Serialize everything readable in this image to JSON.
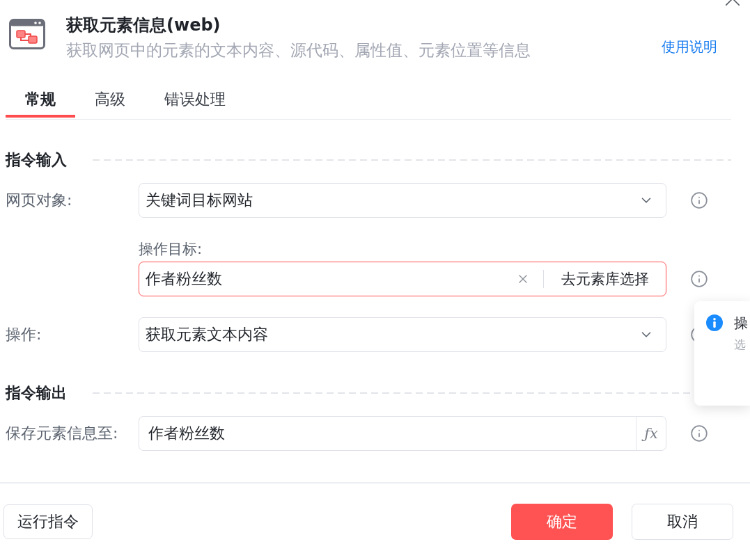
{
  "dialog": {
    "title": "获取元素信息(web)",
    "description": "获取网页中的元素的文本内容、源代码、属性值、元素位置等信息",
    "help_link": "使用说明"
  },
  "tabs": [
    {
      "label": "常规",
      "selected": true
    },
    {
      "label": "高级",
      "selected": false
    },
    {
      "label": "错误处理",
      "selected": false
    }
  ],
  "sections": [
    {
      "title": "指令输入",
      "fields": [
        {
          "kind": "select",
          "label": "网页对象:",
          "value": "关键词目标网站"
        },
        {
          "kind": "element_picker",
          "label": "操作目标:",
          "value": "作者粉丝数",
          "invalid": true,
          "button": "去元素库选择"
        },
        {
          "kind": "select",
          "label": "操作:",
          "value": "获取元素文本内容"
        }
      ]
    },
    {
      "title": "指令输出",
      "fields": [
        {
          "kind": "expression",
          "label": "保存元素信息至:",
          "value": "作者粉丝数",
          "button": "ƒx"
        }
      ]
    }
  ],
  "popover": {
    "title": "操",
    "text": "选"
  },
  "footer": {
    "left_buttons": [
      {
        "label": "运行指令",
        "kind": "default"
      }
    ],
    "right_buttons": [
      {
        "label": "确定",
        "kind": "primary"
      },
      {
        "label": "取消",
        "kind": "default"
      }
    ]
  }
}
